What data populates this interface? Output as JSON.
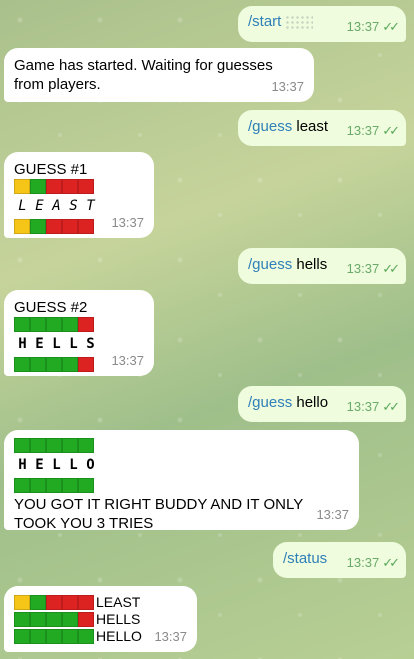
{
  "messages": {
    "m1": {
      "cmd": "/start",
      "time": "13:37"
    },
    "m2": {
      "text": "Game has started. Waiting for guesses from players.",
      "time": "13:37"
    },
    "m3": {
      "cmd": "/guess",
      "arg": " least",
      "time": "13:37"
    },
    "m4": {
      "title": "GUESS #1",
      "letters": [
        "L",
        "E",
        "A",
        "S",
        "T"
      ],
      "time": "13:37"
    },
    "m5": {
      "cmd": "/guess",
      "arg": " hells",
      "time": "13:37"
    },
    "m6": {
      "title": "GUESS #2",
      "letters": [
        "H",
        "E",
        "L",
        "L",
        "S"
      ],
      "time": "13:37"
    },
    "m7": {
      "cmd": "/guess",
      "arg": " hello",
      "time": "13:37"
    },
    "m8": {
      "letters": [
        "H",
        "E",
        "L",
        "L",
        "O"
      ],
      "text": "YOU GOT IT RIGHT BUDDY AND IT ONLY TOOK YOU 3 TRIES",
      "time": "13:37"
    },
    "m9": {
      "cmd": "/status",
      "time": "13:37"
    },
    "m10": {
      "words": [
        "LEAST",
        "HELLS",
        "HELLO"
      ],
      "time": "13:37"
    }
  },
  "tile_colors": {
    "green": "#22aa22",
    "red": "#dd2222",
    "yellow": "#f5c518"
  }
}
